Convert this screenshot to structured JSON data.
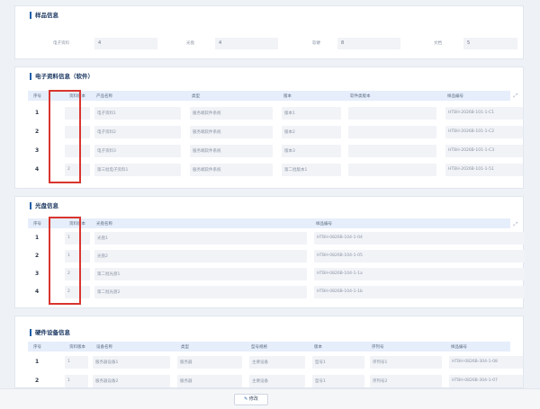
{
  "basic_info": {
    "title": "样品信息",
    "fields": [
      {
        "label": "电子资料",
        "value": "4"
      },
      {
        "label": "光盘",
        "value": "4"
      },
      {
        "label": "软硬",
        "value": "8"
      },
      {
        "label": "文档",
        "value": "5"
      }
    ]
  },
  "electronic": {
    "title": "电子资料信息（软件）",
    "headers": [
      "序号",
      "资料版本",
      "产品名称",
      "类型",
      "版本",
      "软件类版本",
      "样品编号"
    ],
    "rows": [
      {
        "num": "1",
        "cells": [
          "",
          "电子资料1",
          "服务端软件系统",
          "版本1",
          "",
          "HTBH-2026B-101-1-C1"
        ]
      },
      {
        "num": "2",
        "cells": [
          "",
          "电子资料2",
          "服务端软件系统",
          "版本2",
          "",
          "HTBH-2026B-101-1-C2"
        ]
      },
      {
        "num": "3",
        "cells": [
          "",
          "电子资料3",
          "服务端软件系统",
          "版本3",
          "",
          "HTBH-2026B-101-1-C3"
        ]
      },
      {
        "num": "4",
        "cells": [
          "2",
          "第三批电子资料1",
          "服务端软件系统",
          "第二批版本1",
          "",
          "HTBH-2026B-101-1-51"
        ]
      }
    ]
  },
  "disc": {
    "title": "光盘信息",
    "headers": [
      "序号",
      "资料版本",
      "光盘名称",
      "样品编号"
    ],
    "rows": [
      {
        "num": "1",
        "cells": [
          "1",
          "光盘1",
          "HTBH-0826B-104-1-04"
        ]
      },
      {
        "num": "2",
        "cells": [
          "1",
          "光盘2",
          "HTBH-0826B-104-1-05"
        ]
      },
      {
        "num": "3",
        "cells": [
          "2",
          "第二批光盘1",
          "HTBH-0826B-104-1-1a"
        ]
      },
      {
        "num": "4",
        "cells": [
          "2",
          "第二批光盘2",
          "HTBH-0826B-104-1-1b"
        ]
      }
    ]
  },
  "hardware": {
    "title": "硬件设备信息",
    "headers": [
      "序号",
      "资料版本",
      "设备名称",
      "类型",
      "型号规格",
      "版本",
      "序列号",
      "样品编号"
    ],
    "rows": [
      {
        "num": "1",
        "cells": [
          "1",
          "服务器设备1",
          "服务器",
          "主要设备",
          "型号1",
          "序列号1",
          "HTBH-0826B-304-1-08"
        ]
      },
      {
        "num": "2",
        "cells": [
          "1",
          "服务器设备2",
          "服务器",
          "主要设备",
          "型号1",
          "序列号2",
          "HTBH-0826B-304-1-07"
        ]
      }
    ]
  },
  "footer": {
    "button_label": "修改",
    "button_icon": "pencil-icon"
  },
  "colors": {
    "highlight": "#d9352f",
    "header_bg": "#e6eefb",
    "accent": "#1f5faa"
  }
}
